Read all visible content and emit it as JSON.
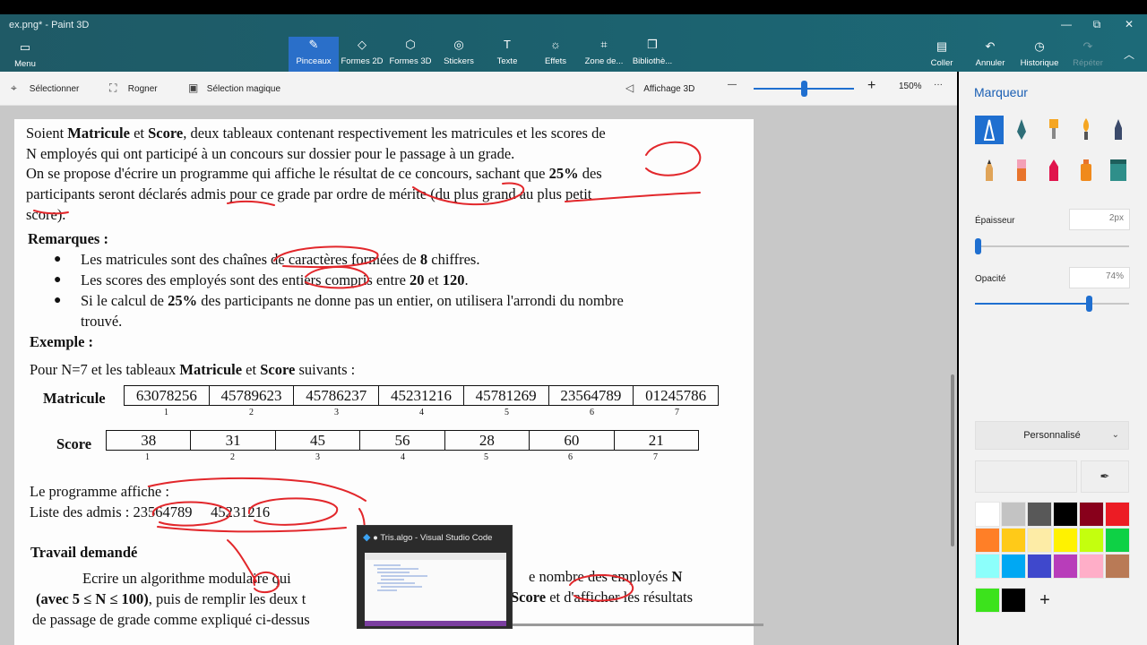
{
  "window": {
    "title": "ex.png* - Paint 3D",
    "minimize": "—",
    "restore": "⧉",
    "close": "✕"
  },
  "ribbon": {
    "menu": {
      "label": "Menu",
      "icon": "folder-icon"
    },
    "tools": [
      {
        "label": "Pinceaux",
        "icon": "brush-icon",
        "active": true
      },
      {
        "label": "Formes 2D",
        "icon": "shapes-2d-icon"
      },
      {
        "label": "Formes 3D",
        "icon": "cube-icon"
      },
      {
        "label": "Stickers",
        "icon": "sticker-icon"
      },
      {
        "label": "Texte",
        "icon": "text-icon"
      },
      {
        "label": "Effets",
        "icon": "sun-icon"
      },
      {
        "label": "Zone de...",
        "icon": "canvas-icon"
      },
      {
        "label": "Bibliothè...",
        "icon": "library-icon"
      }
    ],
    "right_tools": [
      {
        "label": "Coller",
        "icon": "paste-icon"
      },
      {
        "label": "Annuler",
        "icon": "undo-icon"
      },
      {
        "label": "Historique",
        "icon": "history-icon"
      },
      {
        "label": "Répéter",
        "icon": "redo-icon",
        "disabled": true
      }
    ],
    "collapse": "︿"
  },
  "toolbar": {
    "select": "Sélectionner",
    "crop": "Rogner",
    "magic_select": "Sélection magique",
    "view3d": "Affichage 3D",
    "zoom_minus": "—",
    "zoom_plus": "+",
    "zoom_level": "150%",
    "zoom_fraction": 0.5,
    "more": "···"
  },
  "document": {
    "p1": [
      "Soient ",
      "Matricule",
      " et ",
      "Score",
      ", deux tableaux contenant respectivement les matricules et les scores de"
    ],
    "p2": "N employés qui ont participé à un concours sur dossier pour le passage à un grade.",
    "p3": [
      "On se propose d'écrire un programme qui affiche le résultat de ce concours, sachant que ",
      "25%",
      " des"
    ],
    "p4": [
      "participants seront déclarés ",
      "admis",
      " pour ce grade par ",
      "ordre de mérite",
      " (du ",
      "plus grand au plus petit"
    ],
    "p5": "score).",
    "remarks_title": "Remarques :",
    "bullets": [
      [
        "Les matricules sont des chaînes de caractères formées de ",
        "8",
        " chiffres."
      ],
      [
        "Les scores des employés sont des entiers compris entre ",
        "20",
        " et ",
        "120",
        "."
      ],
      [
        "Si le calcul de ",
        "25%",
        " des participants ne donne pas un entier, on utilisera l'arrondi du nombre"
      ]
    ],
    "bullet3_cont": "trouvé.",
    "example_title": "Exemple :",
    "example_intro": [
      "Pour N=7 et les tableaux ",
      "Matricule",
      " et ",
      "Score",
      " suivants :"
    ],
    "matricule_label": "Matricule",
    "matricules": [
      "63078256",
      "45789623",
      "45786237",
      "45231216",
      "45781269",
      "23564789",
      "01245786"
    ],
    "score_label": "Score",
    "scores": [
      "38",
      "31",
      "45",
      "56",
      "28",
      "60",
      "21"
    ],
    "indices": [
      "1",
      "2",
      "3",
      "4",
      "5",
      "6",
      "7"
    ],
    "program_shows": "Le programme affiche :",
    "admis_label": "Liste des admis : ",
    "admis": [
      "23564789",
      "45231216"
    ],
    "work_title": "Travail demandé",
    "w1": [
      "Ecrire   un algorithme modulaire   qui",
      "e nombre   des employés   ",
      "N"
    ],
    "w2": [
      "(avec 5 ≤ N ≤ 100)",
      ", puis de remplir les deux t",
      "Score",
      " et d'afficher les résultats"
    ],
    "w3": "de passage de grade comme expliqué ci-dessus"
  },
  "taskbar_preview": {
    "title": "● Tris.algo - Visual Studio Code",
    "icon": "vscode-icon"
  },
  "panel": {
    "title": "Marqueur",
    "brushes": [
      "marker-icon",
      "calligraphy-pen-icon",
      "oil-brush-icon",
      "watercolor-icon",
      "pixel-pen-icon",
      "pencil-icon",
      "eraser-icon",
      "crayon-icon",
      "spray-can-icon",
      "fill-bucket-icon"
    ],
    "thickness_label": "Épaisseur",
    "thickness_value": "2px",
    "thickness_fraction": 0.02,
    "opacity_label": "Opacité",
    "opacity_value": "74%",
    "opacity_fraction": 0.74,
    "color_dropdown": "Personnalisé",
    "colors": [
      "#ffffff",
      "#c3c3c3",
      "#585858",
      "#000000",
      "#88001b",
      "#ec1c24",
      "#ff7f27",
      "#ffca18",
      "#fdeca6",
      "#fff200",
      "#c4ff0e",
      "#0ed145",
      "#8cfffb",
      "#00a8f3",
      "#3f48cc",
      "#b83dba",
      "#ffaec8",
      "#b97a56"
    ],
    "custom_colors": [
      "#3ce31c",
      "#000000"
    ],
    "add_color": "+"
  }
}
